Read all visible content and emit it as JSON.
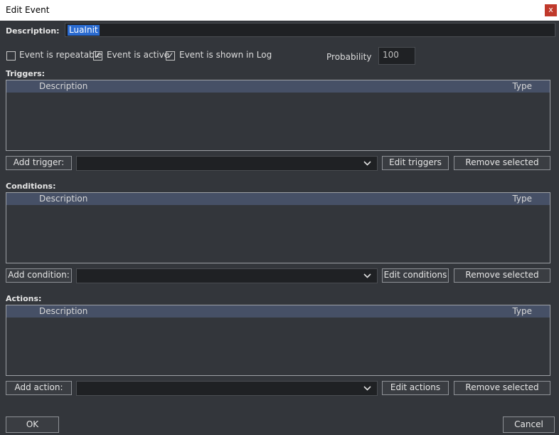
{
  "window": {
    "title": "Edit Event",
    "close_label": "x"
  },
  "description": {
    "label": "Description:",
    "value": "LuaInit"
  },
  "options": {
    "repeatable": {
      "label": "Event is repeatable",
      "checked": false
    },
    "active": {
      "label": "Event is active",
      "checked": true
    },
    "shown_in_log": {
      "label": "Event is shown in Log",
      "checked": true
    },
    "probability": {
      "label": "Probability",
      "value": "100"
    }
  },
  "triggers": {
    "label": "Triggers:",
    "columns": [
      "Description",
      "Type"
    ],
    "rows": [],
    "add_label": "Add trigger:",
    "selected_type": "",
    "edit_label": "Edit triggers",
    "remove_label": "Remove selected"
  },
  "conditions": {
    "label": "Conditions:",
    "columns": [
      "Description",
      "Type"
    ],
    "rows": [],
    "add_label": "Add condition:",
    "selected_type": "",
    "edit_label": "Edit conditions",
    "remove_label": "Remove selected"
  },
  "actions": {
    "label": "Actions:",
    "columns": [
      "Description",
      "Type"
    ],
    "rows": [],
    "add_label": "Add action:",
    "selected_type": "",
    "edit_label": "Edit actions",
    "remove_label": "Remove selected"
  },
  "footer": {
    "ok_label": "OK",
    "cancel_label": "Cancel"
  },
  "colors": {
    "background": "#33363b",
    "list_header": "#465066",
    "selection": "#2a6bd1",
    "close_button": "#c0392b"
  }
}
